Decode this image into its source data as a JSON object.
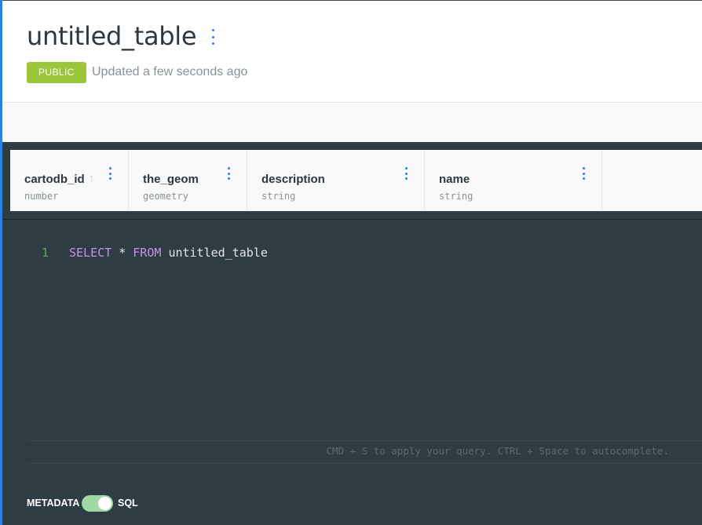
{
  "header": {
    "title": "untitled_table",
    "badge": "PUBLIC",
    "updated": "Updated a few seconds ago"
  },
  "columns": [
    {
      "name": "cartodb_id",
      "type": "number",
      "sorted": "asc"
    },
    {
      "name": "the_geom",
      "type": "geometry"
    },
    {
      "name": "description",
      "type": "string"
    },
    {
      "name": "name",
      "type": "string"
    }
  ],
  "editor": {
    "line_number": "1",
    "query": {
      "kw1": "SELECT",
      "star": "*",
      "kw2": "FROM",
      "table": "untitled_table"
    },
    "hint": "CMD + S to apply your query. CTRL + Space to autocomplete."
  },
  "footer": {
    "left_label": "METADATA",
    "right_label": "SQL",
    "toggle_on": true
  },
  "colors": {
    "accent": "#1785fb",
    "badge": "#9bc63b",
    "editor_bg": "#2e3c43",
    "keyword": "#c990e6",
    "toggle": "#9fd8a4"
  }
}
